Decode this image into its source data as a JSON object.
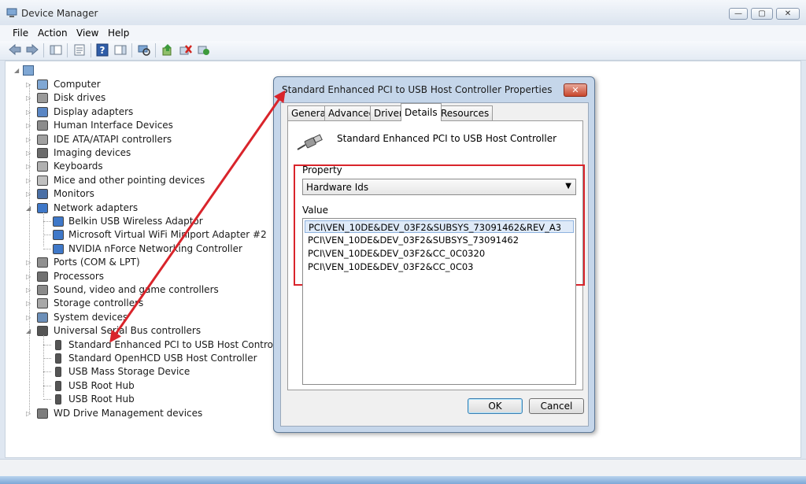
{
  "window": {
    "title": "Device Manager"
  },
  "menu": [
    "File",
    "Action",
    "View",
    "Help"
  ],
  "tree": {
    "root_icon": "computer-icon",
    "items": [
      {
        "label": "Computer",
        "icon": "computer-icon",
        "expanded": false
      },
      {
        "label": "Disk drives",
        "icon": "disk-icon",
        "expanded": false
      },
      {
        "label": "Display adapters",
        "icon": "display-icon",
        "expanded": false
      },
      {
        "label": "Human Interface Devices",
        "icon": "hid-icon",
        "expanded": false
      },
      {
        "label": "IDE ATA/ATAPI controllers",
        "icon": "ide-icon",
        "expanded": false
      },
      {
        "label": "Imaging devices",
        "icon": "camera-icon",
        "expanded": false
      },
      {
        "label": "Keyboards",
        "icon": "keyboard-icon",
        "expanded": false
      },
      {
        "label": "Mice and other pointing devices",
        "icon": "mouse-icon",
        "expanded": false
      },
      {
        "label": "Monitors",
        "icon": "monitor-icon",
        "expanded": false
      },
      {
        "label": "Network adapters",
        "icon": "network-icon",
        "expanded": true,
        "children": [
          "Belkin USB Wireless Adaptor",
          "Microsoft Virtual WiFi Miniport Adapter #2",
          "NVIDIA nForce Networking Controller"
        ]
      },
      {
        "label": "Ports (COM & LPT)",
        "icon": "port-icon",
        "expanded": false
      },
      {
        "label": "Processors",
        "icon": "processor-icon",
        "expanded": false
      },
      {
        "label": "Sound, video and game controllers",
        "icon": "sound-icon",
        "expanded": false
      },
      {
        "label": "Storage controllers",
        "icon": "storage-icon",
        "expanded": false
      },
      {
        "label": "System devices",
        "icon": "system-icon",
        "expanded": false
      },
      {
        "label": "Universal Serial Bus controllers",
        "icon": "usb-icon",
        "expanded": true,
        "children": [
          "Standard Enhanced PCI to USB Host Controller",
          "Standard OpenHCD USB Host Controller",
          "USB Mass Storage Device",
          "USB Root Hub",
          "USB Root Hub"
        ]
      },
      {
        "label": "WD Drive Management devices",
        "icon": "drive-icon",
        "expanded": false
      }
    ]
  },
  "dialog": {
    "title": "Standard Enhanced PCI to USB Host Controller Properties",
    "close_label": "✕",
    "tabs": [
      "General",
      "Advanced",
      "Driver",
      "Details",
      "Resources"
    ],
    "active_tab": "Details",
    "device_name": "Standard Enhanced PCI to USB Host Controller",
    "property_label": "Property",
    "property_value": "Hardware Ids",
    "value_label": "Value",
    "values": [
      "PCI\\VEN_10DE&DEV_03F2&SUBSYS_73091462&REV_A3",
      "PCI\\VEN_10DE&DEV_03F2&SUBSYS_73091462",
      "PCI\\VEN_10DE&DEV_03F2&CC_0C0320",
      "PCI\\VEN_10DE&DEV_03F2&CC_0C03"
    ],
    "ok_label": "OK",
    "cancel_label": "Cancel"
  },
  "colors": {
    "annotation_red": "#d9242b",
    "title_bar": "#dbe4ef"
  }
}
